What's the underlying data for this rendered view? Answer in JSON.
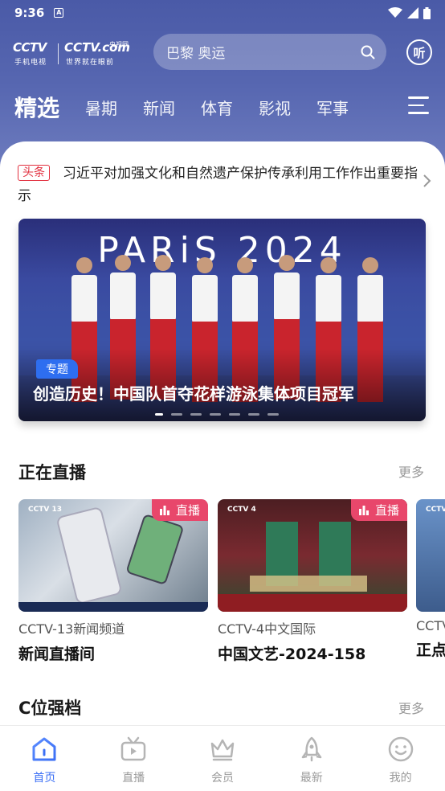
{
  "status_bar": {
    "time": "9:36",
    "notification": "A"
  },
  "header": {
    "logo_main": "CCTV",
    "logo_sub": "手机电视",
    "logo_main2": "CCTV.com",
    "logo_small": "央视网",
    "logo_sub2": "世界就在眼前",
    "search_placeholder": "巴黎 奥运",
    "listen_label": "听"
  },
  "tabs": [
    "精选",
    "暑期",
    "新闻",
    "体育",
    "影视",
    "军事"
  ],
  "headline": {
    "badge": "头条",
    "text": "习近平对加强文化和自然遗产保护传承利用工作作出重要指示"
  },
  "banner": {
    "image_title": "PARiS 2024",
    "tag": "专题",
    "caption": "创造历史！中国队首夺花样游泳集体项目冠军"
  },
  "live_section": {
    "title": "正在直播",
    "more": "更多",
    "badge_label": "直播",
    "cards": [
      {
        "thumb_logo": "CCTV 13",
        "channel": "CCTV-13新闻频道",
        "program": "新闻直播间"
      },
      {
        "thumb_logo": "CCTV 4",
        "channel": "CCTV-4中文国际",
        "program": "中国文艺-2024-158"
      },
      {
        "thumb_logo": "CCTV",
        "channel": "CCTV",
        "program": "正点"
      }
    ]
  },
  "c_section": {
    "title": "C位强档",
    "more": "更多"
  },
  "bottom_nav": [
    {
      "label": "首页",
      "icon": "home-icon",
      "active": true
    },
    {
      "label": "直播",
      "icon": "tv-icon",
      "active": false
    },
    {
      "label": "会员",
      "icon": "crown-icon",
      "active": false
    },
    {
      "label": "最新",
      "icon": "rocket-icon",
      "active": false
    },
    {
      "label": "我的",
      "icon": "smile-icon",
      "active": false
    }
  ],
  "colors": {
    "header_bg": "#4a5aa7",
    "accent_blue": "#3b6ff5",
    "live_badge": "#e8476b",
    "headline_badge": "#e2303f"
  }
}
